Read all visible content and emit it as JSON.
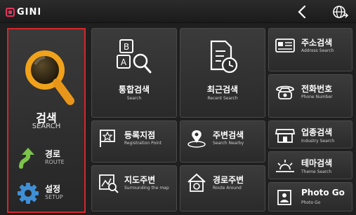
{
  "app": {
    "logo_text": "GINI"
  },
  "sidebar": {
    "search": {
      "label": "검색",
      "sub": "SEARCH"
    },
    "route": {
      "label": "경로",
      "sub": "ROUTE"
    },
    "setup": {
      "label": "설정",
      "sub": "SETUP"
    }
  },
  "tiles": {
    "integrated": {
      "label": "통합검색",
      "sub": "Search"
    },
    "recent": {
      "label": "최근검색",
      "sub": "Recent Search"
    },
    "address": {
      "label": "주소검색",
      "sub": "Address Search"
    },
    "phone": {
      "label": "전화번호",
      "sub": "Phone Number"
    },
    "registration": {
      "label": "등록지점",
      "sub": "Registration Point"
    },
    "nearby": {
      "label": "주변검색",
      "sub": "Search Nearby"
    },
    "industry": {
      "label": "업종검색",
      "sub": "Industry Search"
    },
    "theme": {
      "label": "테마검색",
      "sub": "Theme Search"
    },
    "map_around": {
      "label": "지도주변",
      "sub": "Surrounding the map"
    },
    "route_around": {
      "label": "경로주변",
      "sub": "Route Around"
    },
    "photo": {
      "label": "Photo Go",
      "sub": "Photo Go"
    }
  },
  "colors": {
    "accent": "#d6252b",
    "logo": "#e3345b",
    "magnifier": "#f0a21a"
  }
}
